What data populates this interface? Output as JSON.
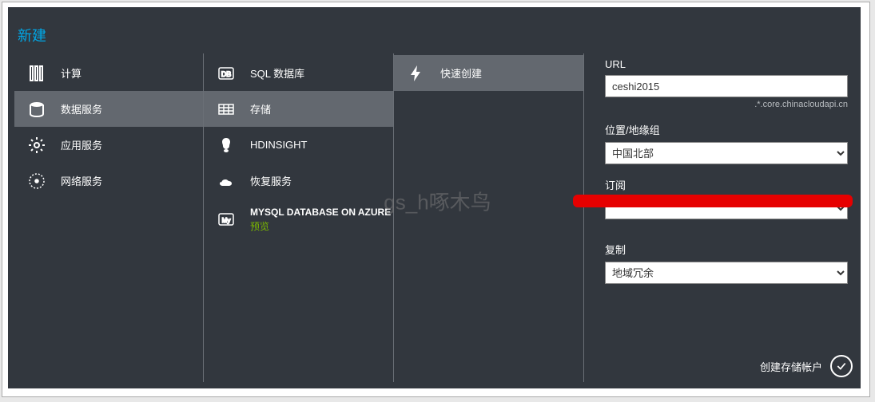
{
  "header": {
    "title": "新建"
  },
  "col1": {
    "items": [
      {
        "label": "计算",
        "icon": "compute-icon"
      },
      {
        "label": "数据服务",
        "icon": "data-icon"
      },
      {
        "label": "应用服务",
        "icon": "app-icon"
      },
      {
        "label": "网络服务",
        "icon": "network-icon"
      }
    ]
  },
  "col2": {
    "items": [
      {
        "label": "SQL 数据库",
        "icon": "db-icon"
      },
      {
        "label": "存储",
        "icon": "storage-icon"
      },
      {
        "label": "HDINSIGHT",
        "icon": "hdinsight-icon"
      },
      {
        "label": "恢复服务",
        "icon": "recovery-icon"
      }
    ],
    "multi": {
      "label": "MYSQL DATABASE ON AZURE",
      "sublabel": "预览",
      "icon": "mysql-icon"
    }
  },
  "col3": {
    "items": [
      {
        "label": "快速创建",
        "icon": "lightning-icon"
      }
    ]
  },
  "form": {
    "url_label": "URL",
    "url_value": "ceshi2015",
    "url_suffix": ".*.core.chinacloudapi.cn",
    "location_label": "位置/地缘组",
    "location_value": "中国北部",
    "subscription_label": "订阅",
    "subscription_value": "",
    "replication_label": "复制",
    "replication_value": "地域冗余"
  },
  "footer": {
    "submit_label": "创建存储帐户"
  },
  "watermark": "gs_h啄木鸟"
}
